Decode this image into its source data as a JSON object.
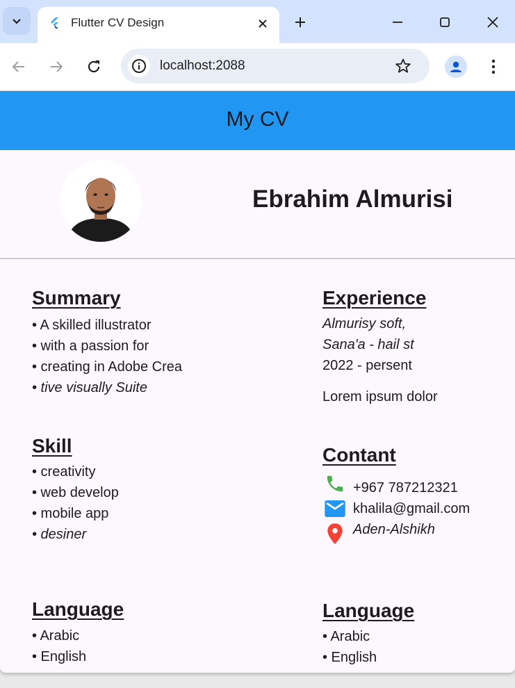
{
  "browser": {
    "tab_title": "Flutter CV Design",
    "url": "localhost:2088",
    "icons": {
      "tab_search": "chevron-down-icon",
      "tab_close": "close-icon",
      "new_tab": "plus-icon",
      "minimize": "minimize-icon",
      "maximize": "maximize-icon",
      "close_window": "close-icon",
      "back": "arrow-left-icon",
      "forward": "arrow-right-icon",
      "reload": "reload-icon",
      "site_info": "info-icon",
      "bookmark": "star-icon",
      "profile": "profile-icon",
      "menu": "more-vert-icon"
    }
  },
  "app": {
    "title": "My CV",
    "appbar_color": "#2196f3",
    "name": "Ebrahim Almurisi",
    "summary": {
      "title": "Summary",
      "lines": [
        "• A skilled illustrator",
        "• with a passion for",
        "• creating in Adobe Crea",
        "• tive visually Suite"
      ]
    },
    "skill": {
      "title": "Skill",
      "lines": [
        "• creativity",
        "• web develop",
        "• mobile app",
        "• desiner"
      ]
    },
    "language_left": {
      "title": "Language",
      "lines": [
        "• Arabic",
        "• English"
      ]
    },
    "experience": {
      "title": "Experience",
      "company": "Almurisy soft,",
      "address": "Sana'a - hail st",
      "period": "2022 - persent",
      "description": "Lorem ipsum dolor"
    },
    "contact": {
      "title": "Contant",
      "phone": "+967 787212321",
      "email": "khalila@gmail.com",
      "location": "Aden-Alshikh",
      "phone_icon_color": "#4caf50",
      "email_icon_color": "#2196f3",
      "location_icon_color": "#f44336"
    },
    "language_right": {
      "title": "Language",
      "lines": [
        "• Arabic",
        "• English"
      ]
    }
  }
}
